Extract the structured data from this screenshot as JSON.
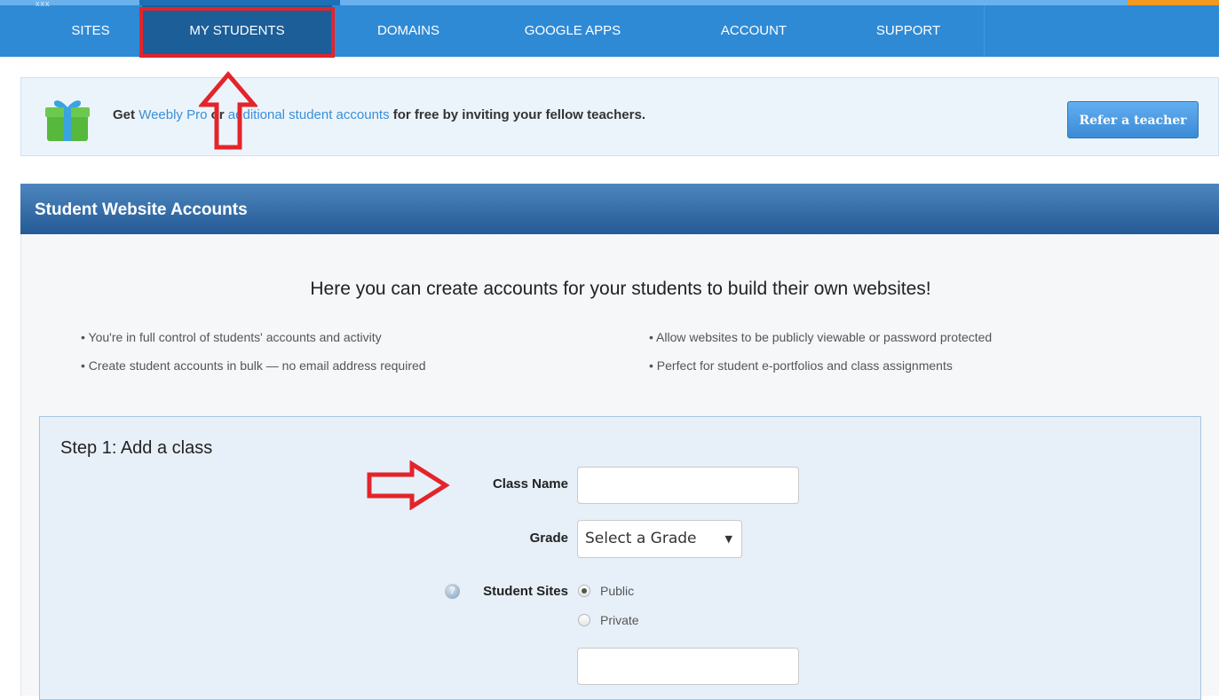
{
  "nav": {
    "items": [
      {
        "label": "SITES"
      },
      {
        "label": "MY STUDENTS",
        "active": true
      },
      {
        "label": "DOMAINS"
      },
      {
        "label": "GOOGLE APPS"
      },
      {
        "label": "ACCOUNT"
      },
      {
        "label": "SUPPORT"
      }
    ],
    "logo_text": "xxx"
  },
  "banner": {
    "prefix": "Get ",
    "link_pro": "Weebly Pro",
    "middle": " or ",
    "link_accounts": "additional student accounts",
    "suffix": " for free by inviting your fellow teachers.",
    "button_label": "Refer a teacher",
    "icon": "gift-icon"
  },
  "panel": {
    "title": "Student Website Accounts",
    "heading": "Here you can create accounts for your students to build their own websites!",
    "bullets": [
      "• You're in full control of students' accounts and activity",
      "• Create student accounts in bulk — no email address required",
      "• Allow websites to be publicly viewable or password protected",
      "• Perfect for student e-portfolios and class assignments"
    ]
  },
  "step1": {
    "title": "Step 1: Add a class",
    "class_name_label": "Class Name",
    "class_name_value": "",
    "grade_label": "Grade",
    "grade_value": "Select a Grade",
    "student_sites_label": "Student Sites",
    "options": [
      {
        "label": "Public",
        "checked": true
      },
      {
        "label": "Private",
        "checked": false
      }
    ],
    "extra_input_value": ""
  },
  "annotation_color": "#e3242b",
  "colors": {
    "nav": "#2f8ad6",
    "nav_active": "#1b5e98",
    "link": "#3a8fd8"
  }
}
